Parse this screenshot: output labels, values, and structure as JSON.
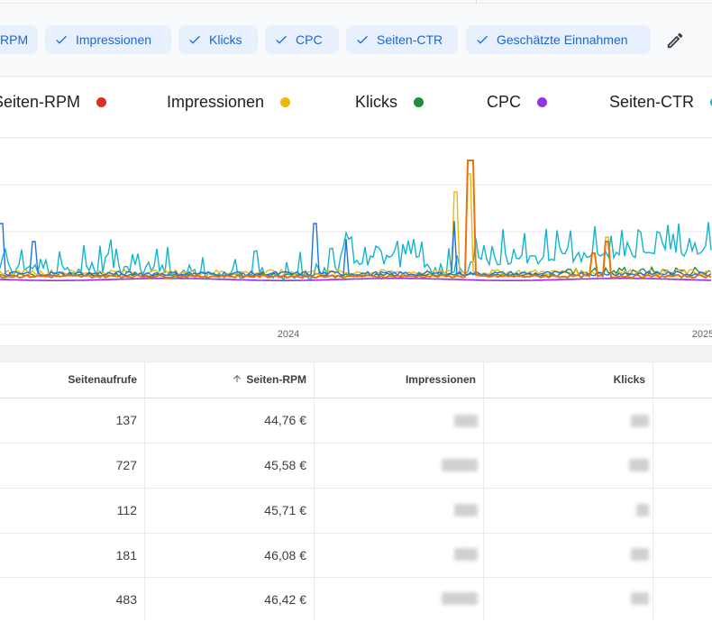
{
  "metric_chips": [
    {
      "label": "RPM"
    },
    {
      "label": "Impressionen"
    },
    {
      "label": "Klicks"
    },
    {
      "label": "CPC"
    },
    {
      "label": "Seiten-CTR"
    },
    {
      "label": "Geschätzte Einnahmen"
    }
  ],
  "legend": [
    {
      "label": "Seiten-RPM",
      "color": "#d93025"
    },
    {
      "label": "Impressionen",
      "color": "#f2b50f"
    },
    {
      "label": "Klicks",
      "color": "#1e8e3e"
    },
    {
      "label": "CPC",
      "color": "#9334e6"
    },
    {
      "label": "Seiten-CTR",
      "color": "#12b5cb"
    }
  ],
  "chart_data": {
    "type": "line",
    "x_tick_labels": [
      "2024",
      "2025"
    ],
    "series_colors": [
      "#1a73e8",
      "#f2b50f",
      "#1e8e3e",
      "#9334e6",
      "#12b5cb",
      "#e8710a"
    ],
    "grid": true
  },
  "table": {
    "columns": [
      {
        "label": "Seitenaufrufe",
        "sorted": false
      },
      {
        "label": "Seiten-RPM",
        "sorted": true,
        "sort_icon": "arrow-up-icon"
      },
      {
        "label": "Impressionen",
        "sorted": false
      },
      {
        "label": "Klicks",
        "sorted": false
      }
    ],
    "rows": [
      {
        "seitenaufrufe": "137",
        "seiten_rpm": "44,76 €"
      },
      {
        "seitenaufrufe": "727",
        "seiten_rpm": "45,58 €"
      },
      {
        "seitenaufrufe": "112",
        "seiten_rpm": "45,71 €"
      },
      {
        "seitenaufrufe": "181",
        "seiten_rpm": "46,08 €"
      },
      {
        "seitenaufrufe": "483",
        "seiten_rpm": "46,42 €"
      }
    ]
  }
}
